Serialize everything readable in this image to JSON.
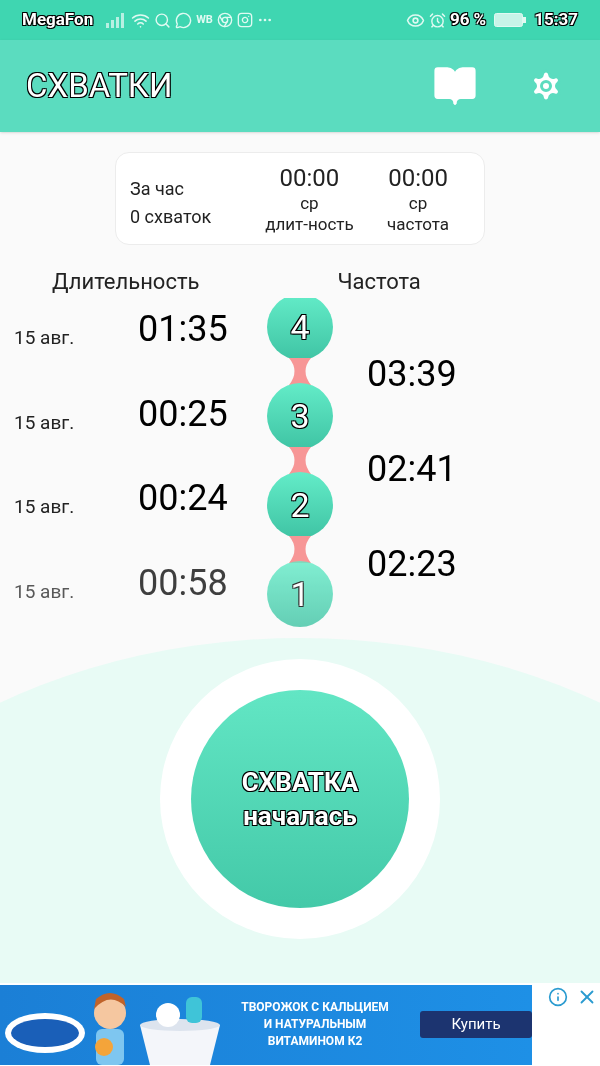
{
  "status_bar": {
    "carrier": "MegaFon",
    "app_badge": "WB",
    "battery": "96 %",
    "time": "15:37"
  },
  "app_bar": {
    "title": "СХВАТКИ"
  },
  "summary": {
    "period": "За час",
    "count": "0 схваток",
    "avg_duration": {
      "value": "00:00",
      "label_1": "ср",
      "label_2": "длит-ность"
    },
    "avg_frequency": {
      "value": "00:00",
      "label_1": "ср",
      "label_2": "частота"
    }
  },
  "columns": {
    "duration": "Длительность",
    "frequency": "Частота"
  },
  "contractions": [
    {
      "number": "4",
      "date": "15 авг.",
      "duration": "01:35"
    },
    {
      "number": "3",
      "date": "15 авг.",
      "duration": "00:25"
    },
    {
      "number": "2",
      "date": "15 авг.",
      "duration": "00:24"
    },
    {
      "number": "1",
      "date": "15 авг.",
      "duration": "00:58"
    }
  ],
  "intervals": [
    "03:39",
    "02:41",
    "02:23"
  ],
  "start_button": {
    "line_1": "СХВАТКА",
    "line_2": "началась"
  },
  "ad": {
    "headline_1": "ТВОРОЖОК С КАЛЬЦИЕМ",
    "headline_2": "И НАТУРАЛЬНЫМ",
    "headline_3": "ВИТАМИНОМ К2",
    "button": "Купить"
  }
}
